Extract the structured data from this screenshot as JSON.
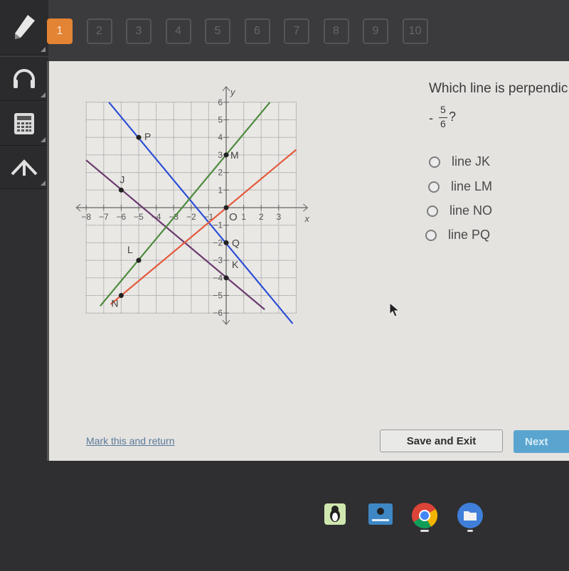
{
  "question_nav": {
    "items": [
      "1",
      "2",
      "3",
      "4",
      "5",
      "6",
      "7",
      "8",
      "9",
      "10"
    ],
    "active_index": 0,
    "active_color": "#e38434"
  },
  "side_tools": [
    {
      "name": "pencil-icon"
    },
    {
      "name": "headphones-icon"
    },
    {
      "name": "calculator-icon"
    },
    {
      "name": "reference-icon"
    }
  ],
  "question": {
    "text": "Which line is perpendic",
    "slope_sign": "-",
    "slope_numerator": "5",
    "slope_denominator": "6",
    "suffix": "?"
  },
  "options": [
    {
      "label": "line JK"
    },
    {
      "label": "line LM"
    },
    {
      "label": "line NO"
    },
    {
      "label": "line PQ"
    }
  ],
  "footer": {
    "mark_link": "Mark this and return",
    "save_label": "Save and Exit",
    "next_label": "Next"
  },
  "shelf": [
    {
      "name": "penguin-app-icon"
    },
    {
      "name": "typing-app-icon"
    },
    {
      "name": "chrome-icon"
    },
    {
      "name": "files-icon"
    }
  ],
  "chart_data": {
    "type": "line",
    "title": "",
    "xlabel": "x",
    "ylabel": "y",
    "xlim": [
      -8,
      4
    ],
    "ylim": [
      -6,
      6
    ],
    "grid": true,
    "x_ticks": [
      "-8",
      "-7",
      "-6",
      "-5",
      "-4",
      "-3",
      "-2",
      "-1",
      "1",
      "2",
      "3"
    ],
    "y_ticks": [
      "-6",
      "-5",
      "-4",
      "-3",
      "-2",
      "-1",
      "1",
      "2",
      "3",
      "4",
      "5",
      "6"
    ],
    "origin_label": "O",
    "series": [
      {
        "name": "PQ",
        "color": "#2d4fd6",
        "points": [
          {
            "label": "P",
            "x": -5,
            "y": 4
          },
          {
            "label": "Q",
            "x": 0,
            "y": -2
          }
        ],
        "extent": [
          [
            -6.7,
            6
          ],
          [
            3.8,
            -6.6
          ]
        ]
      },
      {
        "name": "JK",
        "color": "#6b3a6e",
        "points": [
          {
            "label": "J",
            "x": -6,
            "y": 1
          },
          {
            "label": "K",
            "x": 0,
            "y": -4
          }
        ],
        "extent": [
          [
            -8,
            2.7
          ],
          [
            2.2,
            -5.8
          ]
        ]
      },
      {
        "name": "LM",
        "color": "#4e8a3e",
        "points": [
          {
            "label": "L",
            "x": -5,
            "y": -3
          },
          {
            "label": "M",
            "x": 0,
            "y": 3
          }
        ],
        "extent": [
          [
            -7.2,
            -5.6
          ],
          [
            2.5,
            6
          ]
        ]
      },
      {
        "name": "NO",
        "color": "#e4593c",
        "points": [
          {
            "label": "N",
            "x": -6,
            "y": -5
          },
          {
            "label": "O",
            "x": 0,
            "y": 0
          }
        ],
        "extent": [
          [
            -6.6,
            -5.5
          ],
          [
            4,
            3.3
          ]
        ]
      }
    ]
  }
}
